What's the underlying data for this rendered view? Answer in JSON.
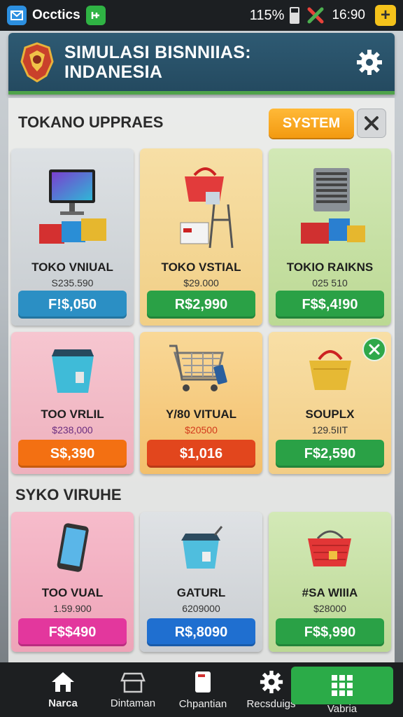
{
  "status_bar": {
    "app_name": "Occtics",
    "battery": "115%",
    "time": "16:90"
  },
  "header": {
    "title_line1": "SIMULASI BISNNIIAS:",
    "title_line2": "INDANESIA"
  },
  "section1": {
    "title": "TOKANO UPPRAES",
    "system_button": "SYSTEM"
  },
  "section2": {
    "title": "SYKO VIRUHE"
  },
  "cards": [
    {
      "name": "TOKO VNIUAL",
      "sub": "S235.590",
      "price": "F!$,050",
      "price_color": "#2b8fc4",
      "bg": "#d3d8dc"
    },
    {
      "name": "TOKO VSTIAL",
      "sub": "$29.000",
      "price": "R$2,990",
      "price_color": "#2aa146",
      "bg": "#f3d79a"
    },
    {
      "name": "TOKIO RAIKNS",
      "sub": "025 510",
      "price": "F$$,4!90",
      "price_color": "#2aa146",
      "bg": "#c8e1a6"
    },
    {
      "name": "TOO VRLIL",
      "sub": "$238,000",
      "price": "S$,390",
      "price_color": "#f37012",
      "bg": "#f1bcc7"
    },
    {
      "name": "Y/80 VITUAL",
      "sub": "$20500",
      "price": "$1,016",
      "price_color": "#e2461d",
      "bg": "#f6cb7e"
    },
    {
      "name": "SOUPLX",
      "sub": "129.5IIT",
      "price": "F$2,590",
      "price_color": "#2aa146",
      "bg": "#f5d797"
    },
    {
      "name": "TOO VUAL",
      "sub": "1.59.900",
      "price": "F$$490",
      "price_color": "#e3379d",
      "bg": "#f4b3c4"
    },
    {
      "name": "GATURL",
      "sub": "6209000",
      "price": "R$,8090",
      "price_color": "#1f6fd0",
      "bg": "#d5d9dc"
    },
    {
      "name": "#SA WIIIA",
      "sub": "$28000",
      "price": "F$$,990",
      "price_color": "#2aa146",
      "bg": "#c6e0a4"
    }
  ],
  "nav": {
    "items": [
      "Narca",
      "Dintaman",
      "Chpantian",
      "Recsduigs",
      "Vabria"
    ]
  },
  "icons": {
    "settings": "gear-icon",
    "close": "close-icon",
    "check": "check-icon",
    "home": "home-icon",
    "apps": "grid-icon"
  }
}
